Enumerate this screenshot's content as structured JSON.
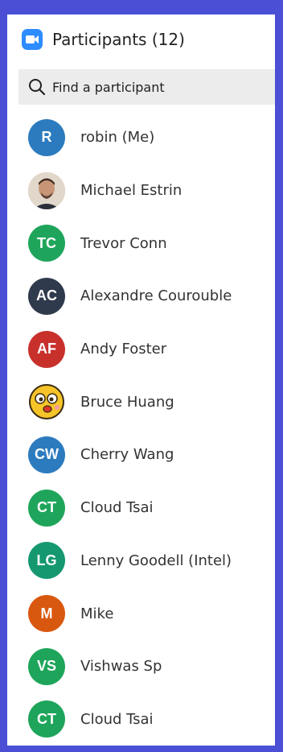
{
  "window": {
    "title": "Participants (12)"
  },
  "search": {
    "placeholder": "Find a participant"
  },
  "participants": [
    {
      "name": "robin (Me)",
      "initials": "R",
      "color": "#2c7bbf",
      "avatar": "initials"
    },
    {
      "name": "Michael Estrin",
      "initials": "",
      "color": "#c9a88e",
      "avatar": "photo-icon"
    },
    {
      "name": "Trevor Conn",
      "initials": "TC",
      "color": "#1fa55b",
      "avatar": "initials"
    },
    {
      "name": "Alexandre Courouble",
      "initials": "AC",
      "color": "#2f3a4c",
      "avatar": "initials"
    },
    {
      "name": "Andy Foster",
      "initials": "AF",
      "color": "#c8302c",
      "avatar": "initials"
    },
    {
      "name": "Bruce Huang",
      "initials": "",
      "color": "#f6c429",
      "avatar": "emoji-face-icon"
    },
    {
      "name": "Cherry Wang",
      "initials": "CW",
      "color": "#2c7bbf",
      "avatar": "initials"
    },
    {
      "name": "Cloud Tsai",
      "initials": "CT",
      "color": "#1fa55b",
      "avatar": "initials"
    },
    {
      "name": "Lenny Goodell (Intel)",
      "initials": "LG",
      "color": "#159870",
      "avatar": "initials"
    },
    {
      "name": "Mike",
      "initials": "M",
      "color": "#d9580f",
      "avatar": "initials"
    },
    {
      "name": "Vishwas Sp",
      "initials": "VS",
      "color": "#1fa55b",
      "avatar": "initials"
    },
    {
      "name": "Cloud Tsai",
      "initials": "CT",
      "color": "#1fa55b",
      "avatar": "initials"
    }
  ]
}
